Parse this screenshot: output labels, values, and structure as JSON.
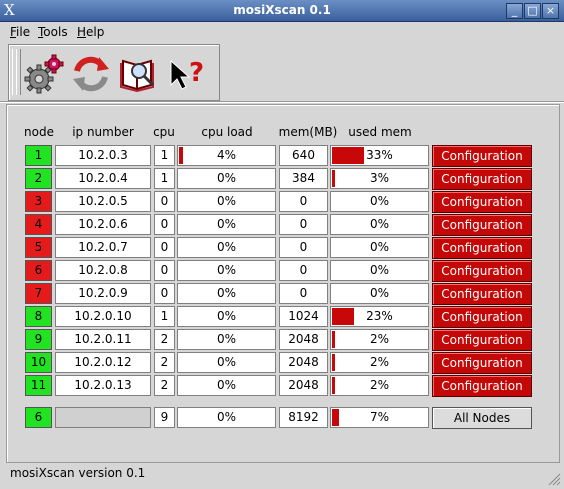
{
  "window": {
    "title": "mosiXscan 0.1"
  },
  "menu": [
    {
      "label": "File",
      "underline": "F",
      "rest": "ile"
    },
    {
      "label": "Tools",
      "underline": "T",
      "rest": "ools"
    },
    {
      "label": "Help",
      "underline": "H",
      "rest": "elp"
    }
  ],
  "toolbar": [
    "settings-gears-icon",
    "refresh-arrows-icon",
    "book-search-icon",
    "whats-this-help-icon"
  ],
  "headers": {
    "node": "node",
    "ip": "ip number",
    "cpu": "cpu",
    "cpu_load": "cpu load",
    "mem": "mem(MB)",
    "used_mem": "used mem"
  },
  "rows": [
    {
      "node": "1",
      "status": "up",
      "ip": "10.2.0.3",
      "cpu": "1",
      "cpu_load": "4%",
      "cpu_load_value": 4,
      "mem": "640",
      "used_mem": "33%",
      "used_mem_value": 33,
      "button": "Configuration"
    },
    {
      "node": "2",
      "status": "up",
      "ip": "10.2.0.4",
      "cpu": "1",
      "cpu_load": "0%",
      "cpu_load_value": 0,
      "mem": "384",
      "used_mem": "3%",
      "used_mem_value": 3,
      "button": "Configuration"
    },
    {
      "node": "3",
      "status": "down",
      "ip": "10.2.0.5",
      "cpu": "0",
      "cpu_load": "0%",
      "cpu_load_value": 0,
      "mem": "0",
      "used_mem": "0%",
      "used_mem_value": 0,
      "button": "Configuration"
    },
    {
      "node": "4",
      "status": "down",
      "ip": "10.2.0.6",
      "cpu": "0",
      "cpu_load": "0%",
      "cpu_load_value": 0,
      "mem": "0",
      "used_mem": "0%",
      "used_mem_value": 0,
      "button": "Configuration"
    },
    {
      "node": "5",
      "status": "down",
      "ip": "10.2.0.7",
      "cpu": "0",
      "cpu_load": "0%",
      "cpu_load_value": 0,
      "mem": "0",
      "used_mem": "0%",
      "used_mem_value": 0,
      "button": "Configuration"
    },
    {
      "node": "6",
      "status": "down",
      "ip": "10.2.0.8",
      "cpu": "0",
      "cpu_load": "0%",
      "cpu_load_value": 0,
      "mem": "0",
      "used_mem": "0%",
      "used_mem_value": 0,
      "button": "Configuration"
    },
    {
      "node": "7",
      "status": "down",
      "ip": "10.2.0.9",
      "cpu": "0",
      "cpu_load": "0%",
      "cpu_load_value": 0,
      "mem": "0",
      "used_mem": "0%",
      "used_mem_value": 0,
      "button": "Configuration"
    },
    {
      "node": "8",
      "status": "up",
      "ip": "10.2.0.10",
      "cpu": "1",
      "cpu_load": "0%",
      "cpu_load_value": 0,
      "mem": "1024",
      "used_mem": "23%",
      "used_mem_value": 23,
      "button": "Configuration"
    },
    {
      "node": "9",
      "status": "up",
      "ip": "10.2.0.11",
      "cpu": "2",
      "cpu_load": "0%",
      "cpu_load_value": 0,
      "mem": "2048",
      "used_mem": "2%",
      "used_mem_value": 2,
      "button": "Configuration"
    },
    {
      "node": "10",
      "status": "up",
      "ip": "10.2.0.12",
      "cpu": "2",
      "cpu_load": "0%",
      "cpu_load_value": 0,
      "mem": "2048",
      "used_mem": "2%",
      "used_mem_value": 2,
      "button": "Configuration"
    },
    {
      "node": "11",
      "status": "up",
      "ip": "10.2.0.13",
      "cpu": "2",
      "cpu_load": "0%",
      "cpu_load_value": 0,
      "mem": "2048",
      "used_mem": "2%",
      "used_mem_value": 2,
      "button": "Configuration"
    }
  ],
  "totals": {
    "node": "6",
    "cpu": "9",
    "cpu_load": "0%",
    "cpu_load_value": 0,
    "mem": "8192",
    "used_mem": "7%",
    "used_mem_value": 7,
    "button": "All Nodes"
  },
  "status_bar": "mosiXscan version 0.1",
  "colors": {
    "up": "#21e321",
    "down": "#e51b1b",
    "bar": "#c80808",
    "config_button": "#c40808"
  }
}
